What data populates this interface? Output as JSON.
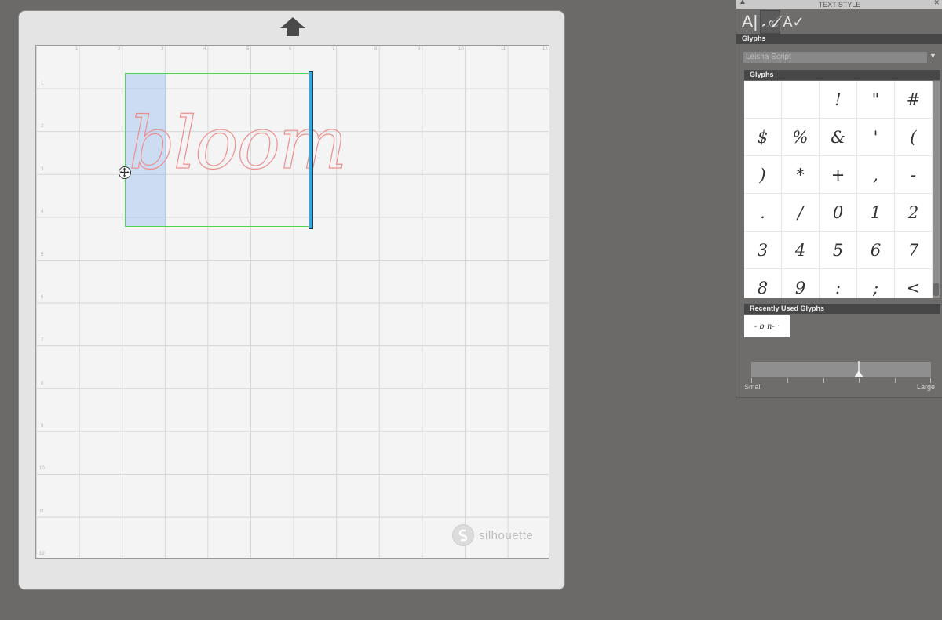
{
  "canvas": {
    "design_text": "bloom",
    "brand": "silhouette",
    "ruler_labels_top": [
      "1",
      "2",
      "3",
      "4",
      "5",
      "6",
      "7",
      "8",
      "9",
      "10",
      "11",
      "12"
    ],
    "ruler_labels_left": [
      "1",
      "2",
      "3",
      "4",
      "5",
      "6",
      "7",
      "8",
      "9",
      "10",
      "11",
      "12"
    ]
  },
  "panel": {
    "title": "TEXT STYLE",
    "collapse_icon": "▲",
    "close_icon": "✕",
    "tabs": [
      {
        "icon": "text-style-tab-icon",
        "glyph": "A|"
      },
      {
        "icon": "glyphs-tab-icon",
        "glyph": "𝒜"
      },
      {
        "icon": "spelling-tab-icon",
        "glyph": "A✓"
      }
    ],
    "section_label": "Glyphs",
    "font_name": "Leisha Script",
    "glyphs_label": "Glyphs",
    "glyphs": [
      "",
      "",
      "!",
      "\"",
      "#",
      "$",
      "%",
      "&",
      "'",
      "(",
      ")",
      "*",
      "+",
      ",",
      "-",
      ".",
      "/",
      "0",
      "1",
      "2",
      "3",
      "4",
      "5",
      "6",
      "7",
      "8",
      "9",
      ":",
      ";",
      "<"
    ],
    "recent_label": "Recently Used Glyphs",
    "recent_glyphs": "- b n- ·",
    "size_min_label": "Small",
    "size_max_label": "Large",
    "size_value": 0.6
  }
}
